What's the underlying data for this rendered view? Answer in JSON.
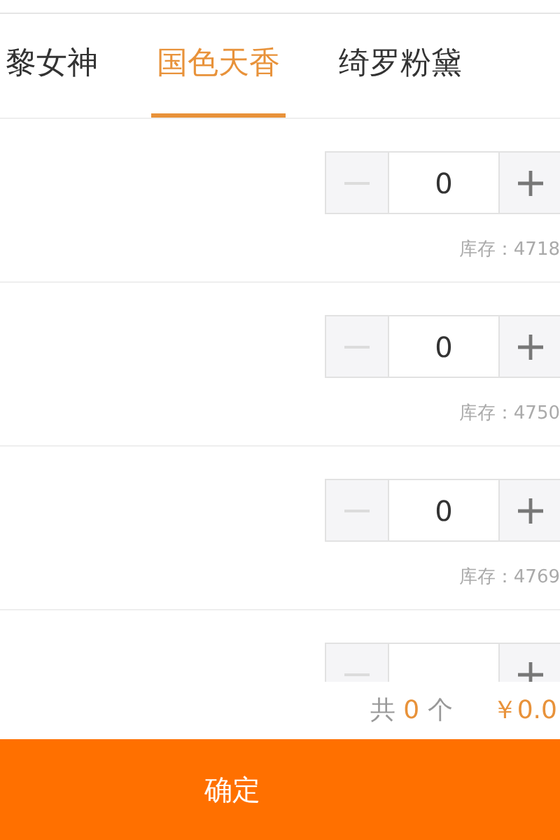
{
  "tabs": [
    {
      "label": "黎女神",
      "selected": false
    },
    {
      "label": "国色天香",
      "selected": true
    },
    {
      "label": "绮罗粉黛",
      "selected": false
    }
  ],
  "items": [
    {
      "quantity": "0",
      "stock": "库存：4718"
    },
    {
      "quantity": "0",
      "stock": "库存：4750"
    },
    {
      "quantity": "0",
      "stock": "库存：4769"
    }
  ],
  "more_rows_below": true,
  "summary": {
    "prefix": "共",
    "count": "0",
    "unit": "个",
    "total": "￥0.0"
  },
  "confirm_button": "确定"
}
